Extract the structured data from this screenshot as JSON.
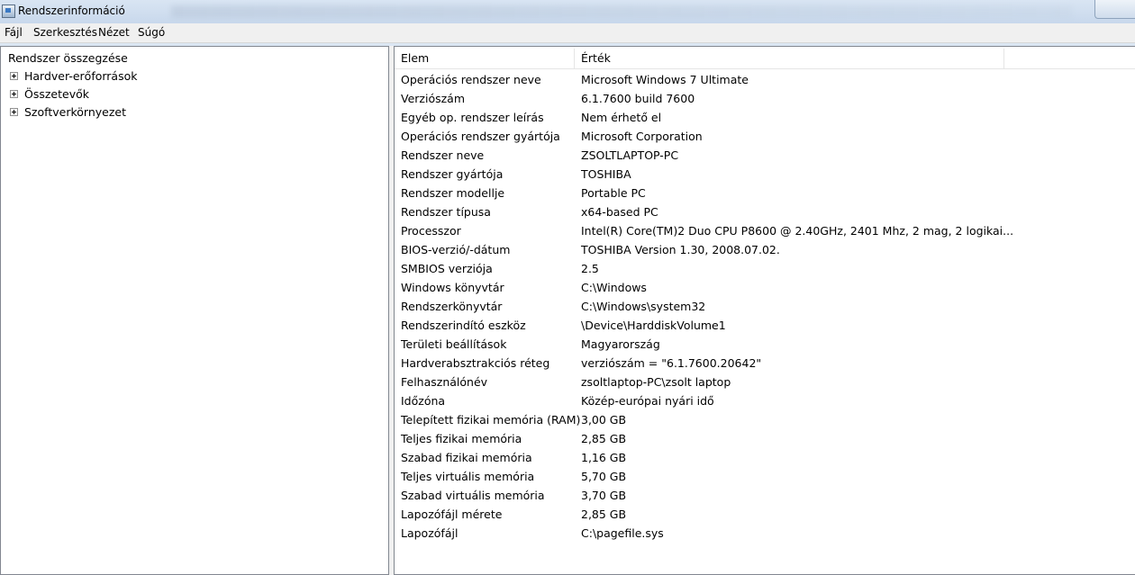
{
  "window": {
    "title": "Rendszerinformáció"
  },
  "menu": [
    "Fájl",
    "Szerkesztés",
    "Nézet",
    "Súgó"
  ],
  "tree": {
    "root": "Rendszer összegzése",
    "nodes": [
      "Hardver-erőforrások",
      "Összetevők",
      "Szoftverkörnyezet"
    ]
  },
  "list": {
    "columns": [
      "Elem",
      "Érték"
    ],
    "rows": [
      {
        "item": "Operációs rendszer neve",
        "value": "Microsoft Windows 7 Ultimate"
      },
      {
        "item": "Verziószám",
        "value": "6.1.7600 build 7600"
      },
      {
        "item": "Egyéb op. rendszer leírás",
        "value": "Nem érhető el"
      },
      {
        "item": "Operációs rendszer gyártója",
        "value": "Microsoft Corporation"
      },
      {
        "item": "Rendszer neve",
        "value": "ZSOLTLAPTOP-PC"
      },
      {
        "item": "Rendszer gyártója",
        "value": "TOSHIBA"
      },
      {
        "item": "Rendszer modellje",
        "value": "Portable PC"
      },
      {
        "item": "Rendszer típusa",
        "value": "x64-based PC"
      },
      {
        "item": "Processzor",
        "value": "Intel(R) Core(TM)2 Duo CPU     P8600  @ 2.40GHz, 2401 Mhz, 2 mag, 2 logikai..."
      },
      {
        "item": "BIOS-verzió/-dátum",
        "value": "TOSHIBA Version 1.30, 2008.07.02."
      },
      {
        "item": "SMBIOS verziója",
        "value": "2.5"
      },
      {
        "item": "Windows könyvtár",
        "value": "C:\\Windows"
      },
      {
        "item": "Rendszerkönyvtár",
        "value": "C:\\Windows\\system32"
      },
      {
        "item": "Rendszerindító eszköz",
        "value": "\\Device\\HarddiskVolume1"
      },
      {
        "item": "Területi beállítások",
        "value": "Magyarország"
      },
      {
        "item": "Hardverabsztrakciós réteg",
        "value": "verziószám = \"6.1.7600.20642\""
      },
      {
        "item": "Felhasználónév",
        "value": "zsoltlaptop-PC\\zsolt laptop"
      },
      {
        "item": "Időzóna",
        "value": "Közép-európai nyári idő"
      },
      {
        "item": "Telepített fizikai memória (RAM)",
        "value": "3,00 GB"
      },
      {
        "item": "Teljes fizikai memória",
        "value": "2,85 GB"
      },
      {
        "item": "Szabad fizikai memória",
        "value": "1,16 GB"
      },
      {
        "item": "Teljes virtuális memória",
        "value": "5,70 GB"
      },
      {
        "item": "Szabad virtuális memória",
        "value": "3,70 GB"
      },
      {
        "item": "Lapozófájl mérete",
        "value": "2,85 GB"
      },
      {
        "item": "Lapozófájl",
        "value": "C:\\pagefile.sys"
      }
    ]
  }
}
